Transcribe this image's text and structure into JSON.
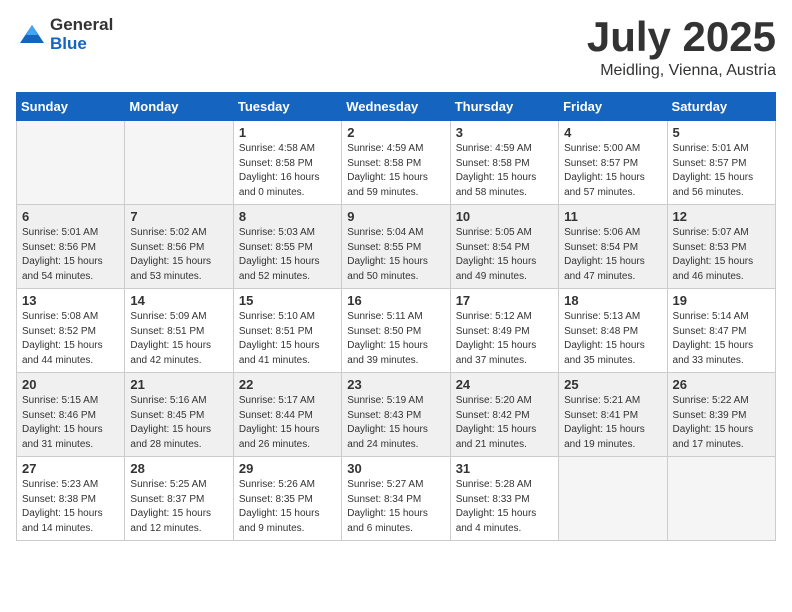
{
  "header": {
    "logo_general": "General",
    "logo_blue": "Blue",
    "month": "July 2025",
    "location": "Meidling, Vienna, Austria"
  },
  "weekdays": [
    "Sunday",
    "Monday",
    "Tuesday",
    "Wednesday",
    "Thursday",
    "Friday",
    "Saturday"
  ],
  "weeks": [
    [
      {
        "day": "",
        "sunrise": "",
        "sunset": "",
        "daylight": "",
        "empty": true
      },
      {
        "day": "",
        "sunrise": "",
        "sunset": "",
        "daylight": "",
        "empty": true
      },
      {
        "day": "1",
        "sunrise": "Sunrise: 4:58 AM",
        "sunset": "Sunset: 8:58 PM",
        "daylight": "Daylight: 16 hours and 0 minutes."
      },
      {
        "day": "2",
        "sunrise": "Sunrise: 4:59 AM",
        "sunset": "Sunset: 8:58 PM",
        "daylight": "Daylight: 15 hours and 59 minutes."
      },
      {
        "day": "3",
        "sunrise": "Sunrise: 4:59 AM",
        "sunset": "Sunset: 8:58 PM",
        "daylight": "Daylight: 15 hours and 58 minutes."
      },
      {
        "day": "4",
        "sunrise": "Sunrise: 5:00 AM",
        "sunset": "Sunset: 8:57 PM",
        "daylight": "Daylight: 15 hours and 57 minutes."
      },
      {
        "day": "5",
        "sunrise": "Sunrise: 5:01 AM",
        "sunset": "Sunset: 8:57 PM",
        "daylight": "Daylight: 15 hours and 56 minutes."
      }
    ],
    [
      {
        "day": "6",
        "sunrise": "Sunrise: 5:01 AM",
        "sunset": "Sunset: 8:56 PM",
        "daylight": "Daylight: 15 hours and 54 minutes."
      },
      {
        "day": "7",
        "sunrise": "Sunrise: 5:02 AM",
        "sunset": "Sunset: 8:56 PM",
        "daylight": "Daylight: 15 hours and 53 minutes."
      },
      {
        "day": "8",
        "sunrise": "Sunrise: 5:03 AM",
        "sunset": "Sunset: 8:55 PM",
        "daylight": "Daylight: 15 hours and 52 minutes."
      },
      {
        "day": "9",
        "sunrise": "Sunrise: 5:04 AM",
        "sunset": "Sunset: 8:55 PM",
        "daylight": "Daylight: 15 hours and 50 minutes."
      },
      {
        "day": "10",
        "sunrise": "Sunrise: 5:05 AM",
        "sunset": "Sunset: 8:54 PM",
        "daylight": "Daylight: 15 hours and 49 minutes."
      },
      {
        "day": "11",
        "sunrise": "Sunrise: 5:06 AM",
        "sunset": "Sunset: 8:54 PM",
        "daylight": "Daylight: 15 hours and 47 minutes."
      },
      {
        "day": "12",
        "sunrise": "Sunrise: 5:07 AM",
        "sunset": "Sunset: 8:53 PM",
        "daylight": "Daylight: 15 hours and 46 minutes."
      }
    ],
    [
      {
        "day": "13",
        "sunrise": "Sunrise: 5:08 AM",
        "sunset": "Sunset: 8:52 PM",
        "daylight": "Daylight: 15 hours and 44 minutes."
      },
      {
        "day": "14",
        "sunrise": "Sunrise: 5:09 AM",
        "sunset": "Sunset: 8:51 PM",
        "daylight": "Daylight: 15 hours and 42 minutes."
      },
      {
        "day": "15",
        "sunrise": "Sunrise: 5:10 AM",
        "sunset": "Sunset: 8:51 PM",
        "daylight": "Daylight: 15 hours and 41 minutes."
      },
      {
        "day": "16",
        "sunrise": "Sunrise: 5:11 AM",
        "sunset": "Sunset: 8:50 PM",
        "daylight": "Daylight: 15 hours and 39 minutes."
      },
      {
        "day": "17",
        "sunrise": "Sunrise: 5:12 AM",
        "sunset": "Sunset: 8:49 PM",
        "daylight": "Daylight: 15 hours and 37 minutes."
      },
      {
        "day": "18",
        "sunrise": "Sunrise: 5:13 AM",
        "sunset": "Sunset: 8:48 PM",
        "daylight": "Daylight: 15 hours and 35 minutes."
      },
      {
        "day": "19",
        "sunrise": "Sunrise: 5:14 AM",
        "sunset": "Sunset: 8:47 PM",
        "daylight": "Daylight: 15 hours and 33 minutes."
      }
    ],
    [
      {
        "day": "20",
        "sunrise": "Sunrise: 5:15 AM",
        "sunset": "Sunset: 8:46 PM",
        "daylight": "Daylight: 15 hours and 31 minutes."
      },
      {
        "day": "21",
        "sunrise": "Sunrise: 5:16 AM",
        "sunset": "Sunset: 8:45 PM",
        "daylight": "Daylight: 15 hours and 28 minutes."
      },
      {
        "day": "22",
        "sunrise": "Sunrise: 5:17 AM",
        "sunset": "Sunset: 8:44 PM",
        "daylight": "Daylight: 15 hours and 26 minutes."
      },
      {
        "day": "23",
        "sunrise": "Sunrise: 5:19 AM",
        "sunset": "Sunset: 8:43 PM",
        "daylight": "Daylight: 15 hours and 24 minutes."
      },
      {
        "day": "24",
        "sunrise": "Sunrise: 5:20 AM",
        "sunset": "Sunset: 8:42 PM",
        "daylight": "Daylight: 15 hours and 21 minutes."
      },
      {
        "day": "25",
        "sunrise": "Sunrise: 5:21 AM",
        "sunset": "Sunset: 8:41 PM",
        "daylight": "Daylight: 15 hours and 19 minutes."
      },
      {
        "day": "26",
        "sunrise": "Sunrise: 5:22 AM",
        "sunset": "Sunset: 8:39 PM",
        "daylight": "Daylight: 15 hours and 17 minutes."
      }
    ],
    [
      {
        "day": "27",
        "sunrise": "Sunrise: 5:23 AM",
        "sunset": "Sunset: 8:38 PM",
        "daylight": "Daylight: 15 hours and 14 minutes."
      },
      {
        "day": "28",
        "sunrise": "Sunrise: 5:25 AM",
        "sunset": "Sunset: 8:37 PM",
        "daylight": "Daylight: 15 hours and 12 minutes."
      },
      {
        "day": "29",
        "sunrise": "Sunrise: 5:26 AM",
        "sunset": "Sunset: 8:35 PM",
        "daylight": "Daylight: 15 hours and 9 minutes."
      },
      {
        "day": "30",
        "sunrise": "Sunrise: 5:27 AM",
        "sunset": "Sunset: 8:34 PM",
        "daylight": "Daylight: 15 hours and 6 minutes."
      },
      {
        "day": "31",
        "sunrise": "Sunrise: 5:28 AM",
        "sunset": "Sunset: 8:33 PM",
        "daylight": "Daylight: 15 hours and 4 minutes."
      },
      {
        "day": "",
        "sunrise": "",
        "sunset": "",
        "daylight": "",
        "empty": true
      },
      {
        "day": "",
        "sunrise": "",
        "sunset": "",
        "daylight": "",
        "empty": true
      }
    ]
  ]
}
